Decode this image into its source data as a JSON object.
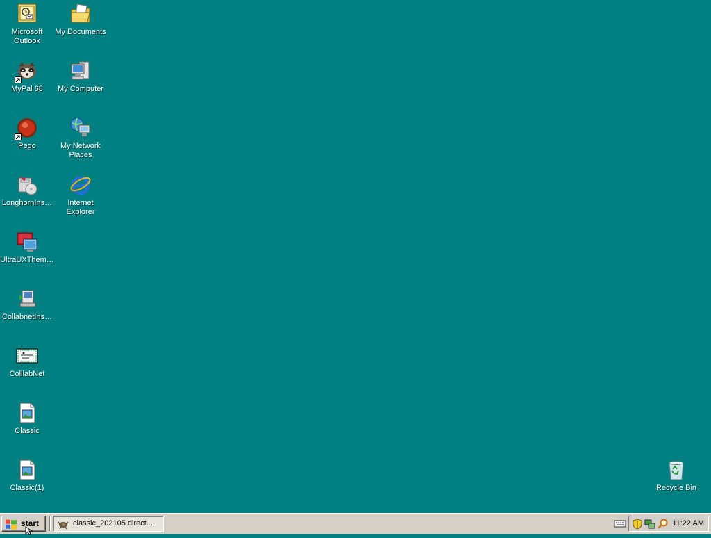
{
  "desktop": {
    "background_color": "#008080",
    "icons": [
      {
        "label": "Microsoft Outlook",
        "icon": "outlook-icon",
        "shortcut": false
      },
      {
        "label": "My Documents",
        "icon": "my-documents-icon",
        "shortcut": false
      },
      {
        "label": "MyPal 68",
        "icon": "mypal-icon",
        "shortcut": true
      },
      {
        "label": "My Computer",
        "icon": "my-computer-icon",
        "shortcut": false
      },
      {
        "label": "Pego",
        "icon": "pego-icon",
        "shortcut": true
      },
      {
        "label": "My Network Places",
        "icon": "network-places-icon",
        "shortcut": false
      },
      {
        "label": "LonghornIns…",
        "icon": "installer-icon",
        "shortcut": false
      },
      {
        "label": "Internet Explorer",
        "icon": "internet-explorer-icon",
        "shortcut": false
      },
      {
        "label": "UltraUXThem…",
        "icon": "ultrauxtheme-icon",
        "shortcut": false
      },
      {
        "label": "CollabnetIns…",
        "icon": "collabnet-installer-icon",
        "shortcut": false
      },
      {
        "label": "ColllabNet",
        "icon": "collabnet-icon",
        "shortcut": false
      },
      {
        "label": "Classic",
        "icon": "image-file-icon",
        "shortcut": false
      },
      {
        "label": "Classic(1)",
        "icon": "image-file-icon",
        "shortcut": false
      },
      {
        "label": "Recycle Bin",
        "icon": "recycle-bin-icon",
        "shortcut": false
      }
    ]
  },
  "taskbar": {
    "start_label": "start",
    "tasks": [
      {
        "label": "classic_202105 direct...",
        "icon": "task-app-icon"
      }
    ],
    "tray": {
      "icons": [
        "keyboard-icon",
        "security-shield-icon",
        "network-icon",
        "search-icon"
      ],
      "clock": "11:22 AM"
    }
  }
}
